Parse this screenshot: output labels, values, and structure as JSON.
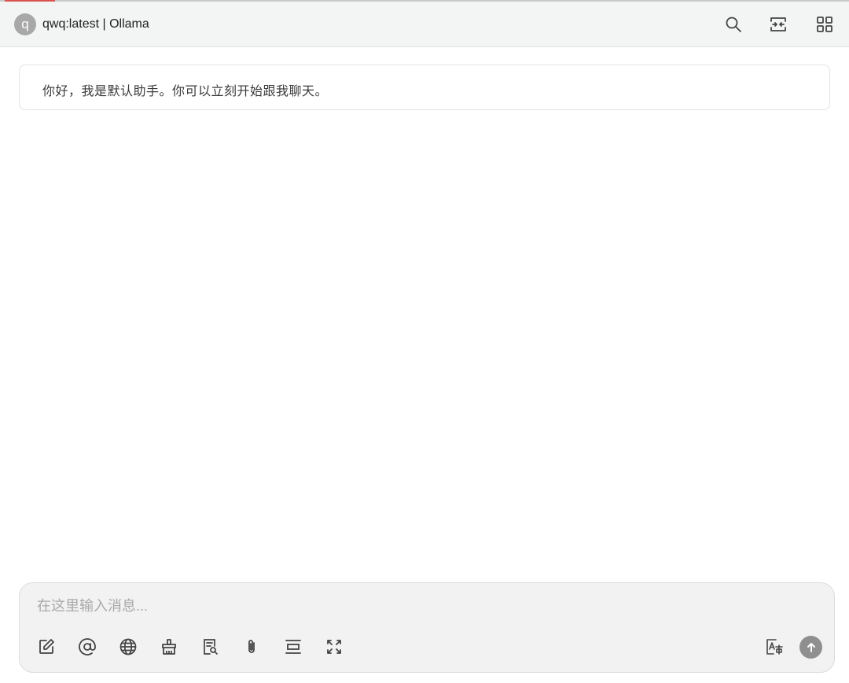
{
  "header": {
    "avatar_letter": "q",
    "title": "qwq:latest | Ollama",
    "icons": [
      "search-icon",
      "expand-horizontal-icon",
      "grid-icon"
    ]
  },
  "messages": [
    {
      "role": "assistant",
      "text": "你好，我是默认助手。你可以立刻开始跟我聊天。"
    }
  ],
  "composer": {
    "placeholder": "在这里输入消息...",
    "value": "",
    "tool_icons": [
      "edit-icon",
      "at-mention-icon",
      "globe-icon",
      "clear-broom-icon",
      "file-search-icon",
      "attachment-icon",
      "text-align-icon",
      "fullscreen-icon",
      "translate-icon"
    ],
    "send_icon": "send-arrow-up-icon"
  },
  "colors": {
    "header_bg": "#f3f4f4",
    "composer_bg": "#f2f2f2",
    "send_button": "#8f8f8f",
    "avatar_bg": "#a8a8a8"
  }
}
